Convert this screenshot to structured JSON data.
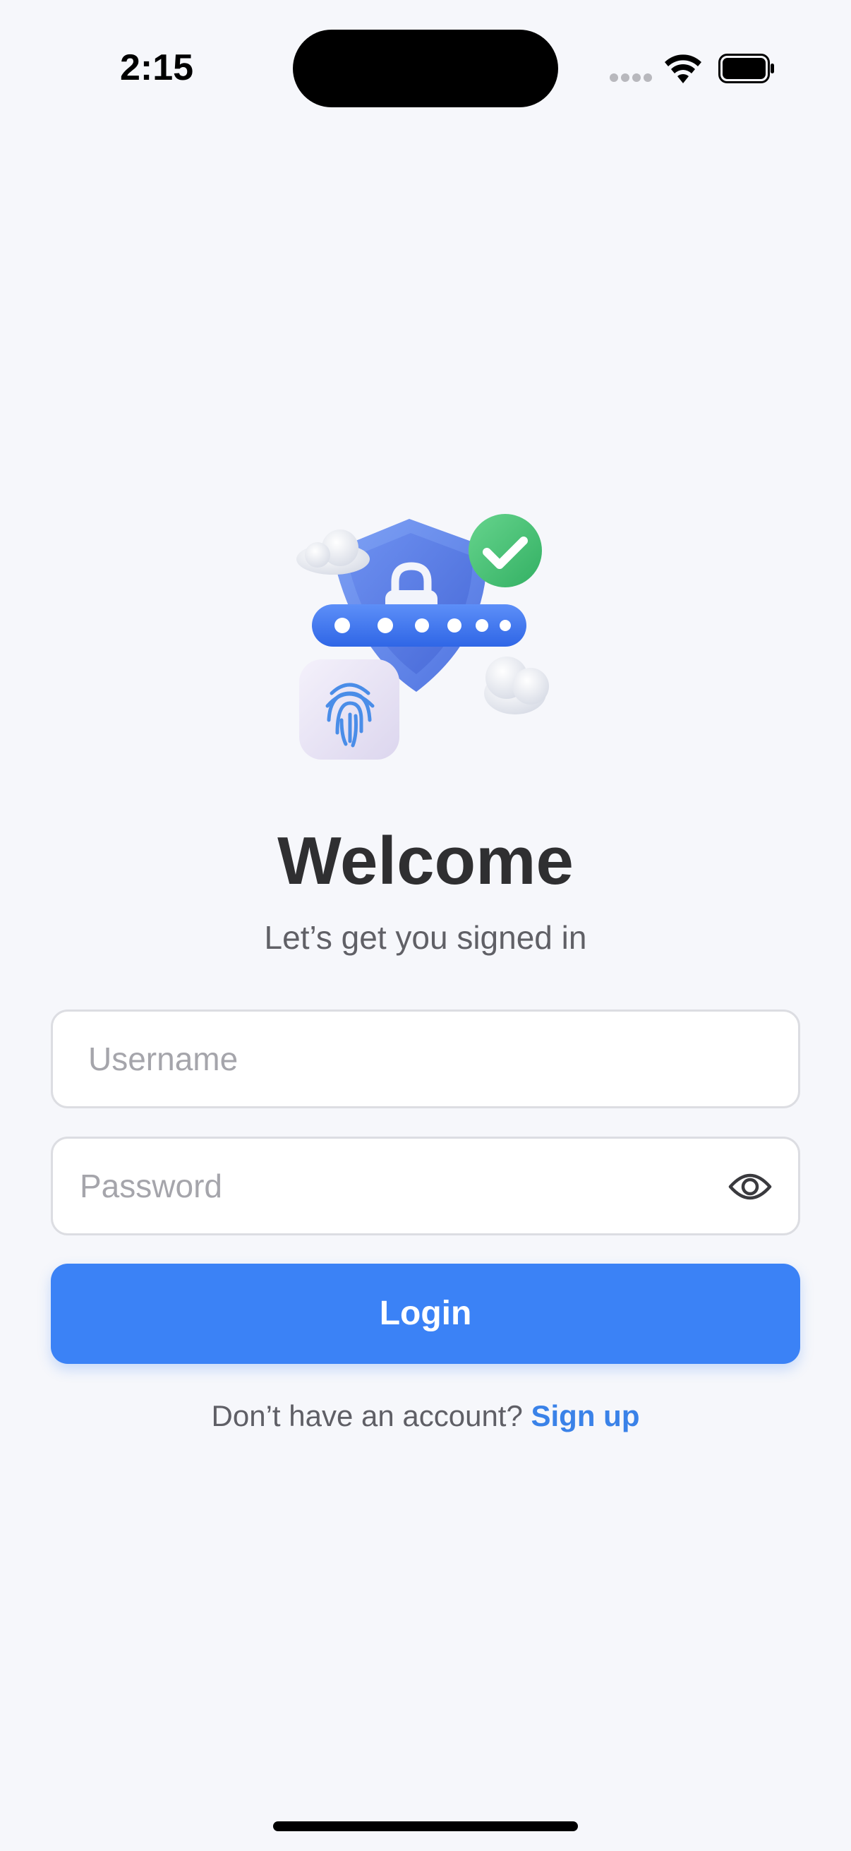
{
  "status_bar": {
    "time": "2:15",
    "icons": [
      "cellular-signal-icon",
      "wifi-icon",
      "battery-icon"
    ]
  },
  "hero": {
    "illustration": "security-shield-illustration",
    "icons": [
      "shield-icon",
      "padlock-icon",
      "checkmark-icon",
      "password-dots-icon",
      "fingerprint-icon",
      "cloud-icon"
    ]
  },
  "welcome": {
    "title": "Welcome",
    "subtitle": "Let’s get you signed in"
  },
  "form": {
    "username_placeholder": "Username",
    "username_value": "",
    "password_placeholder": "Password",
    "password_value": "",
    "password_toggle_icon": "eye-icon",
    "login_label": "Login"
  },
  "signup": {
    "prompt": "Don’t have an account?",
    "link_label": "Sign up"
  },
  "colors": {
    "background": "#f6f7fb",
    "primary": "#3b82f6",
    "link": "#3a82e8",
    "title": "#2f2f31",
    "subtitle": "#606066",
    "field_border": "#dcdde2",
    "check_green": "#4cc47a"
  }
}
